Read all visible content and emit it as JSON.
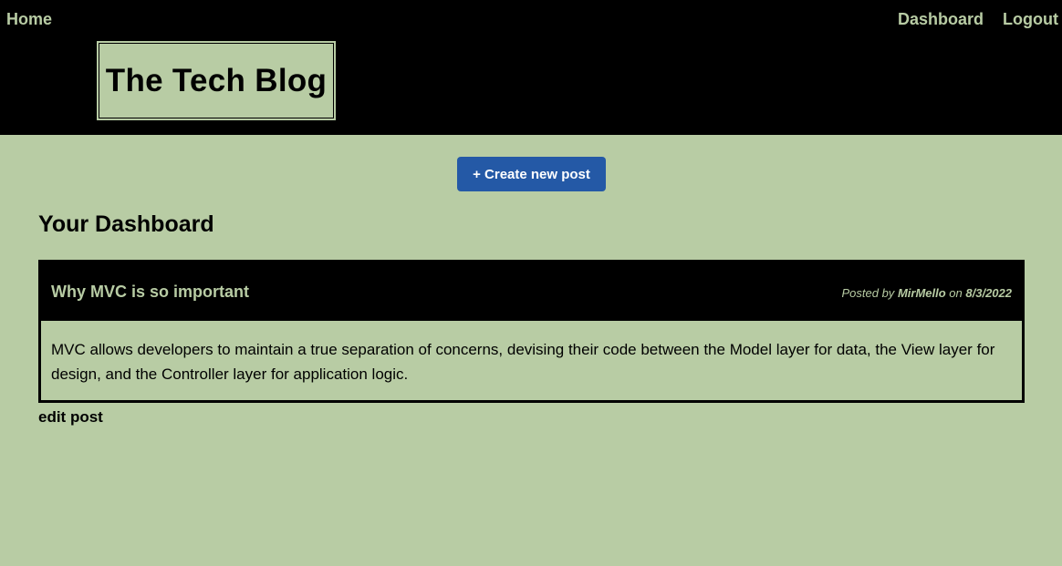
{
  "nav": {
    "home": "Home",
    "dashboard": "Dashboard",
    "logout": "Logout"
  },
  "site": {
    "title": "The Tech Blog"
  },
  "actions": {
    "create_post": "+ Create new post"
  },
  "main": {
    "heading": "Your Dashboard"
  },
  "posts": [
    {
      "title": "Why MVC is so important",
      "posted_by_prefix": "Posted by",
      "author": "MirMello",
      "on_label": "on",
      "date": "8/3/2022",
      "body": "MVC allows developers to maintain a true separation of concerns, devising their code between the Model layer for data, the View layer for design, and the Controller layer for application logic.",
      "edit_label": "edit post"
    }
  ],
  "colors": {
    "background": "#b8cca4",
    "header": "#000000",
    "accent_button": "#2459a6"
  }
}
